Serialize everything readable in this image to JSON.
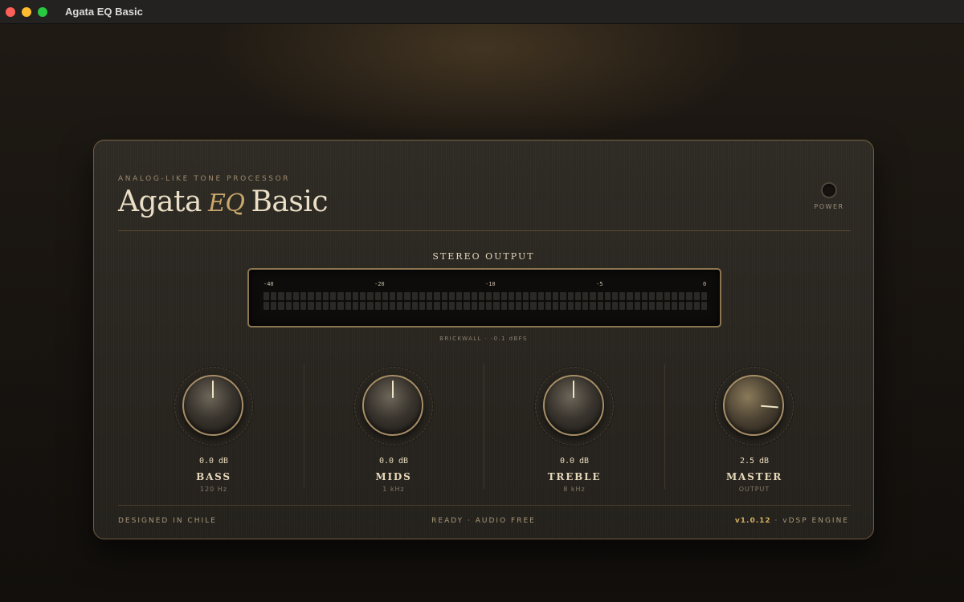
{
  "window": {
    "title": "Agata EQ Basic"
  },
  "header": {
    "subtitle": "ANALOG-LIKE TONE PROCESSOR",
    "brand_left": "Agata",
    "brand_mid": "EQ",
    "brand_right": "Basic",
    "power_label": "POWER"
  },
  "meter": {
    "title": "STEREO OUTPUT",
    "scale": [
      "-40",
      "-20",
      "-10",
      "-5",
      "0"
    ],
    "caption": "BRICKWALL · -0.1 dBFS",
    "segments_per_channel": 60
  },
  "knobs": [
    {
      "value": "0.0 dB",
      "name": "BASS",
      "sub": "120 Hz",
      "level_fraction": 0.5
    },
    {
      "value": "0.0 dB",
      "name": "MIDS",
      "sub": "1 kHz",
      "level_fraction": 0.5
    },
    {
      "value": "0.0 dB",
      "name": "TREBLE",
      "sub": "8 kHz",
      "level_fraction": 0.5
    },
    {
      "value": "2.5 dB",
      "name": "MASTER",
      "sub": "OUTPUT",
      "level_fraction": 0.85
    }
  ],
  "footer": {
    "left": "DESIGNED IN CHILE",
    "center": "READY · AUDIO FREE",
    "version": "v1.0.12",
    "engine": " · vDSP ENGINE"
  },
  "colors": {
    "accent": "#c9a76a",
    "panel": "#2a2620",
    "text": "#eadfc6"
  }
}
